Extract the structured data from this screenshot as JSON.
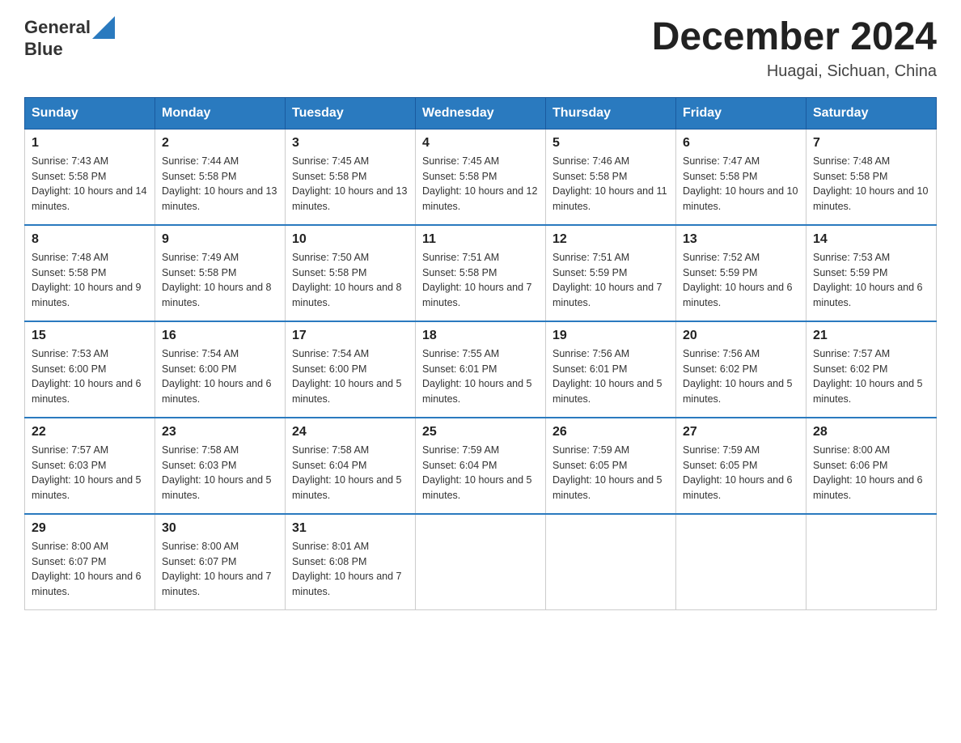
{
  "header": {
    "logo_general": "General",
    "logo_blue": "Blue",
    "month_year": "December 2024",
    "location": "Huagai, Sichuan, China"
  },
  "weekdays": [
    "Sunday",
    "Monday",
    "Tuesday",
    "Wednesday",
    "Thursday",
    "Friday",
    "Saturday"
  ],
  "weeks": [
    [
      {
        "day": "1",
        "sunrise": "7:43 AM",
        "sunset": "5:58 PM",
        "daylight": "10 hours and 14 minutes."
      },
      {
        "day": "2",
        "sunrise": "7:44 AM",
        "sunset": "5:58 PM",
        "daylight": "10 hours and 13 minutes."
      },
      {
        "day": "3",
        "sunrise": "7:45 AM",
        "sunset": "5:58 PM",
        "daylight": "10 hours and 13 minutes."
      },
      {
        "day": "4",
        "sunrise": "7:45 AM",
        "sunset": "5:58 PM",
        "daylight": "10 hours and 12 minutes."
      },
      {
        "day": "5",
        "sunrise": "7:46 AM",
        "sunset": "5:58 PM",
        "daylight": "10 hours and 11 minutes."
      },
      {
        "day": "6",
        "sunrise": "7:47 AM",
        "sunset": "5:58 PM",
        "daylight": "10 hours and 10 minutes."
      },
      {
        "day": "7",
        "sunrise": "7:48 AM",
        "sunset": "5:58 PM",
        "daylight": "10 hours and 10 minutes."
      }
    ],
    [
      {
        "day": "8",
        "sunrise": "7:48 AM",
        "sunset": "5:58 PM",
        "daylight": "10 hours and 9 minutes."
      },
      {
        "day": "9",
        "sunrise": "7:49 AM",
        "sunset": "5:58 PM",
        "daylight": "10 hours and 8 minutes."
      },
      {
        "day": "10",
        "sunrise": "7:50 AM",
        "sunset": "5:58 PM",
        "daylight": "10 hours and 8 minutes."
      },
      {
        "day": "11",
        "sunrise": "7:51 AM",
        "sunset": "5:58 PM",
        "daylight": "10 hours and 7 minutes."
      },
      {
        "day": "12",
        "sunrise": "7:51 AM",
        "sunset": "5:59 PM",
        "daylight": "10 hours and 7 minutes."
      },
      {
        "day": "13",
        "sunrise": "7:52 AM",
        "sunset": "5:59 PM",
        "daylight": "10 hours and 6 minutes."
      },
      {
        "day": "14",
        "sunrise": "7:53 AM",
        "sunset": "5:59 PM",
        "daylight": "10 hours and 6 minutes."
      }
    ],
    [
      {
        "day": "15",
        "sunrise": "7:53 AM",
        "sunset": "6:00 PM",
        "daylight": "10 hours and 6 minutes."
      },
      {
        "day": "16",
        "sunrise": "7:54 AM",
        "sunset": "6:00 PM",
        "daylight": "10 hours and 6 minutes."
      },
      {
        "day": "17",
        "sunrise": "7:54 AM",
        "sunset": "6:00 PM",
        "daylight": "10 hours and 5 minutes."
      },
      {
        "day": "18",
        "sunrise": "7:55 AM",
        "sunset": "6:01 PM",
        "daylight": "10 hours and 5 minutes."
      },
      {
        "day": "19",
        "sunrise": "7:56 AM",
        "sunset": "6:01 PM",
        "daylight": "10 hours and 5 minutes."
      },
      {
        "day": "20",
        "sunrise": "7:56 AM",
        "sunset": "6:02 PM",
        "daylight": "10 hours and 5 minutes."
      },
      {
        "day": "21",
        "sunrise": "7:57 AM",
        "sunset": "6:02 PM",
        "daylight": "10 hours and 5 minutes."
      }
    ],
    [
      {
        "day": "22",
        "sunrise": "7:57 AM",
        "sunset": "6:03 PM",
        "daylight": "10 hours and 5 minutes."
      },
      {
        "day": "23",
        "sunrise": "7:58 AM",
        "sunset": "6:03 PM",
        "daylight": "10 hours and 5 minutes."
      },
      {
        "day": "24",
        "sunrise": "7:58 AM",
        "sunset": "6:04 PM",
        "daylight": "10 hours and 5 minutes."
      },
      {
        "day": "25",
        "sunrise": "7:59 AM",
        "sunset": "6:04 PM",
        "daylight": "10 hours and 5 minutes."
      },
      {
        "day": "26",
        "sunrise": "7:59 AM",
        "sunset": "6:05 PM",
        "daylight": "10 hours and 5 minutes."
      },
      {
        "day": "27",
        "sunrise": "7:59 AM",
        "sunset": "6:05 PM",
        "daylight": "10 hours and 6 minutes."
      },
      {
        "day": "28",
        "sunrise": "8:00 AM",
        "sunset": "6:06 PM",
        "daylight": "10 hours and 6 minutes."
      }
    ],
    [
      {
        "day": "29",
        "sunrise": "8:00 AM",
        "sunset": "6:07 PM",
        "daylight": "10 hours and 6 minutes."
      },
      {
        "day": "30",
        "sunrise": "8:00 AM",
        "sunset": "6:07 PM",
        "daylight": "10 hours and 7 minutes."
      },
      {
        "day": "31",
        "sunrise": "8:01 AM",
        "sunset": "6:08 PM",
        "daylight": "10 hours and 7 minutes."
      },
      null,
      null,
      null,
      null
    ]
  ]
}
